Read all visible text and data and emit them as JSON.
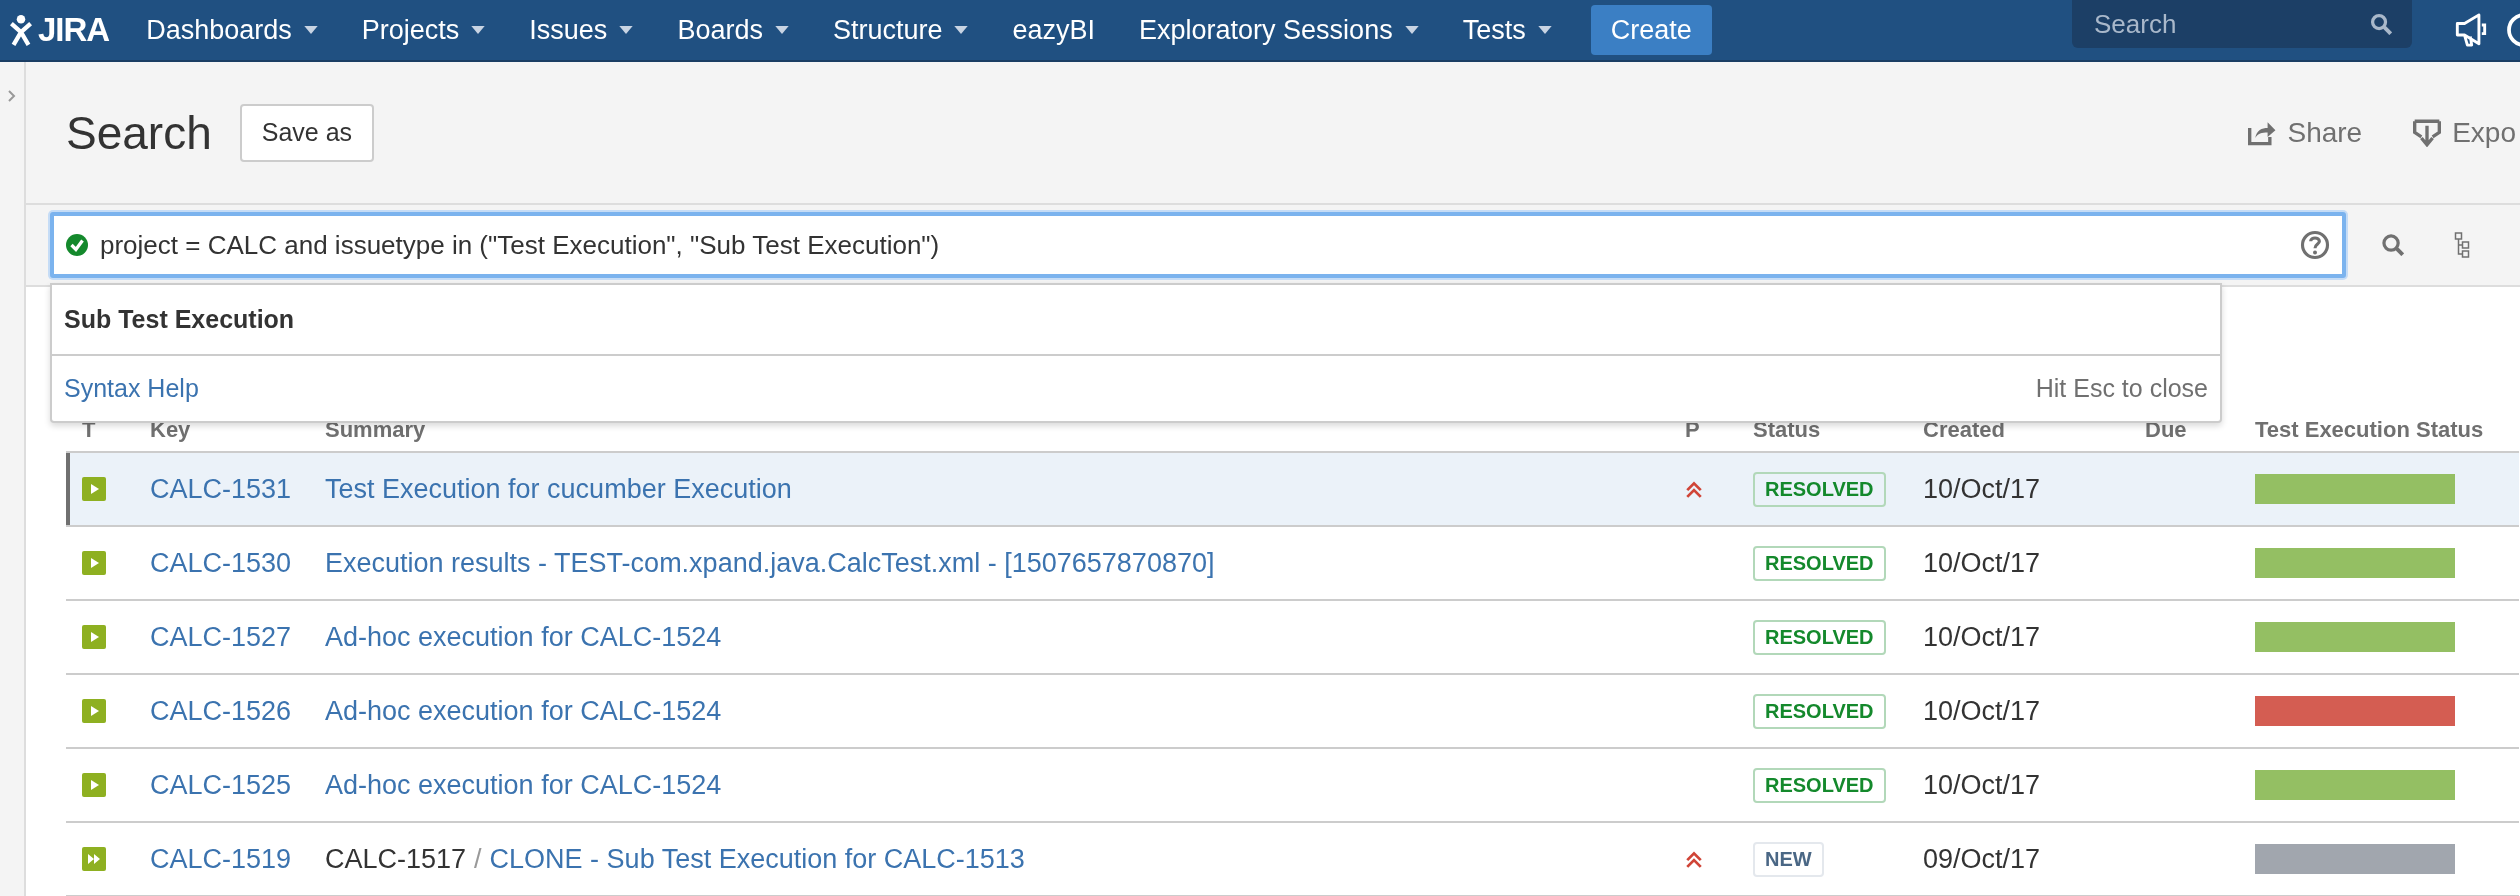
{
  "nav": {
    "logo": "JIRA",
    "items": [
      {
        "label": "Dashboards",
        "dropdown": true
      },
      {
        "label": "Projects",
        "dropdown": true
      },
      {
        "label": "Issues",
        "dropdown": true
      },
      {
        "label": "Boards",
        "dropdown": true
      },
      {
        "label": "Structure",
        "dropdown": true
      },
      {
        "label": "eazyBI",
        "dropdown": false
      },
      {
        "label": "Exploratory Sessions",
        "dropdown": true
      },
      {
        "label": "Tests",
        "dropdown": true
      }
    ],
    "create": "Create",
    "search": {
      "placeholder": "Search"
    }
  },
  "page": {
    "title": "Search",
    "save_as": "Save as",
    "actions": [
      "Share",
      "Expo"
    ]
  },
  "query": {
    "value": "project = CALC and issuetype in (\"Test Execution\", \"Sub Test Execution\")",
    "valid": true
  },
  "suggestions": {
    "items": [
      "Sub Test Execution"
    ],
    "help_link": "Syntax Help",
    "hint": "Hit Esc to close"
  },
  "table": {
    "columns": [
      "T",
      "Key",
      "Summary",
      "P",
      "Status",
      "Created",
      "Due",
      "Test Execution Status"
    ],
    "rows": [
      {
        "kind": "test-execution",
        "key": "CALC-1531",
        "summary": "Test Execution for cucumber Execution",
        "high_priority": true,
        "status": {
          "text": "RESOLVED",
          "kind": "done"
        },
        "created": "10/Oct/17",
        "color": "#94bf63",
        "selected": true
      },
      {
        "kind": "test-execution",
        "high_priority": false,
        "key": "CALC-1530",
        "summary": "Execution results - TEST-com.xpand.java.CalcTest.xml - [1507657870870]",
        "status": {
          "text": "RESOLVED",
          "kind": "done"
        },
        "created": "10/Oct/17",
        "color": "#94bf63",
        "selected": false
      },
      {
        "kind": "test-execution",
        "high_priority": false,
        "key": "CALC-1527",
        "summary": "Ad-hoc execution for CALC-1524",
        "status": {
          "text": "RESOLVED",
          "kind": "done"
        },
        "created": "10/Oct/17",
        "color": "#94bf63",
        "selected": false
      },
      {
        "kind": "test-execution",
        "high_priority": false,
        "key": "CALC-1526",
        "summary": "Ad-hoc execution for CALC-1524",
        "status": {
          "text": "RESOLVED",
          "kind": "done"
        },
        "created": "10/Oct/17",
        "color": "#d45d52",
        "selected": false
      },
      {
        "kind": "test-execution",
        "high_priority": false,
        "key": "CALC-1525",
        "summary": "Ad-hoc execution for CALC-1524",
        "status": {
          "text": "RESOLVED",
          "kind": "done"
        },
        "created": "10/Oct/17",
        "color": "#94bf63",
        "selected": false
      },
      {
        "kind": "sub-test-execution",
        "key": "CALC-1519",
        "parent": "CALC-1517",
        "separator": "/",
        "summary": "CLONE - Sub Test Execution for CALC-1513",
        "high_priority": true,
        "status": {
          "text": "NEW",
          "kind": "new"
        },
        "created": "09/Oct/17",
        "color": "#a1a6ae",
        "selected": false
      }
    ]
  }
}
